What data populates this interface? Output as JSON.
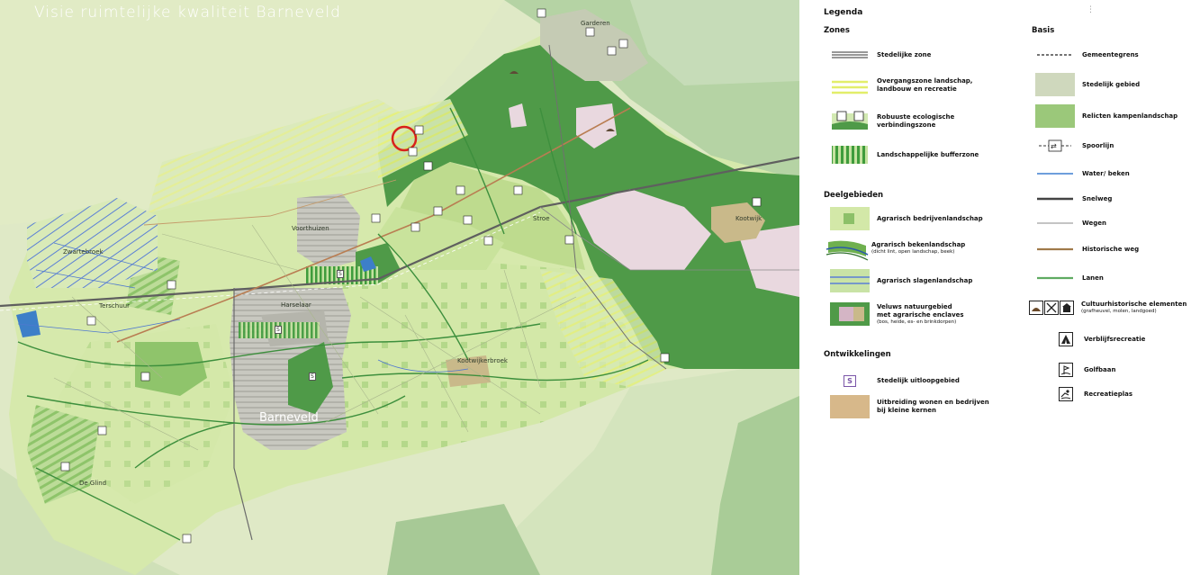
{
  "map": {
    "title": "Visie ruimtelijke kwaliteit Barneveld",
    "places": {
      "garderen": "Garderen",
      "zwartebroek": "Zwartebroek",
      "terschuur": "Terschuur",
      "voorthuizen": "Voorthuizen",
      "harselaar": "Harselaar",
      "barneveld": "Barneveld",
      "stroe": "Stroe",
      "kootwijk": "Kootwijk",
      "kootwijkerbroek": "Kootwijkerbroek",
      "de_glind": "De Glind"
    },
    "marker_s": "S",
    "colors": {
      "pale_green": "#cfe3b4",
      "dark_green": "#4f9a48",
      "mid_green": "#8cc068",
      "urban_grey": "#c9c9c2",
      "pink": "#e8d6df",
      "highlight_circle": "#d8221c"
    }
  },
  "legend": {
    "title": "Legenda",
    "zones": {
      "heading": "Zones",
      "items": [
        "Stedelijke zone",
        "Overgangszone landschap,\nlandbouw en recreatie",
        "Robuuste ecologische\nverbindingszone",
        "Landschappelijke bufferzone"
      ]
    },
    "deelgebieden": {
      "heading": "Deelgebieden",
      "items": [
        {
          "label": "Agrarisch bedrijvenlandschap",
          "note": ""
        },
        {
          "label": "Agrarisch bekenlandschap",
          "note": "(dicht lint, open landschap, beek)"
        },
        {
          "label": "Agrarisch slagenlandschap",
          "note": ""
        },
        {
          "label": "Veluws natuurgebied\nmet agrarische enclaves",
          "note": "(bos, heide, es- en brinkdorpen)"
        }
      ]
    },
    "ontwikkelingen": {
      "heading": "Ontwikkelingen",
      "items": [
        "Stedelijk uitloopgebied",
        "Uitbreiding wonen en bedrijven\nbij kleine kernen"
      ],
      "s_symbol": "S"
    },
    "basis": {
      "heading": "Basis",
      "items": [
        {
          "label": "Gemeentegrens",
          "note": ""
        },
        {
          "label": "Stedelijk gebied",
          "note": ""
        },
        {
          "label": "Relicten kampenlandschap",
          "note": ""
        },
        {
          "label": "Spoorlijn",
          "note": ""
        },
        {
          "label": "Water/ beken",
          "note": ""
        },
        {
          "label": "Snelweg",
          "note": ""
        },
        {
          "label": "Wegen",
          "note": ""
        },
        {
          "label": "Historische weg",
          "note": ""
        },
        {
          "label": "Lanen",
          "note": ""
        },
        {
          "label": "Cultuurhistorische elementen",
          "note": "(grafheuvel, molen, landgoed)"
        },
        {
          "label": "Verblijfsrecreatie",
          "note": ""
        },
        {
          "label": "Golfbaan",
          "note": ""
        },
        {
          "label": "Recreatieplas",
          "note": ""
        }
      ]
    },
    "icons": [
      "grave-mound-icon",
      "windmill-icon",
      "estate-icon",
      "tent-icon",
      "golf-icon",
      "swimmer-icon"
    ]
  }
}
